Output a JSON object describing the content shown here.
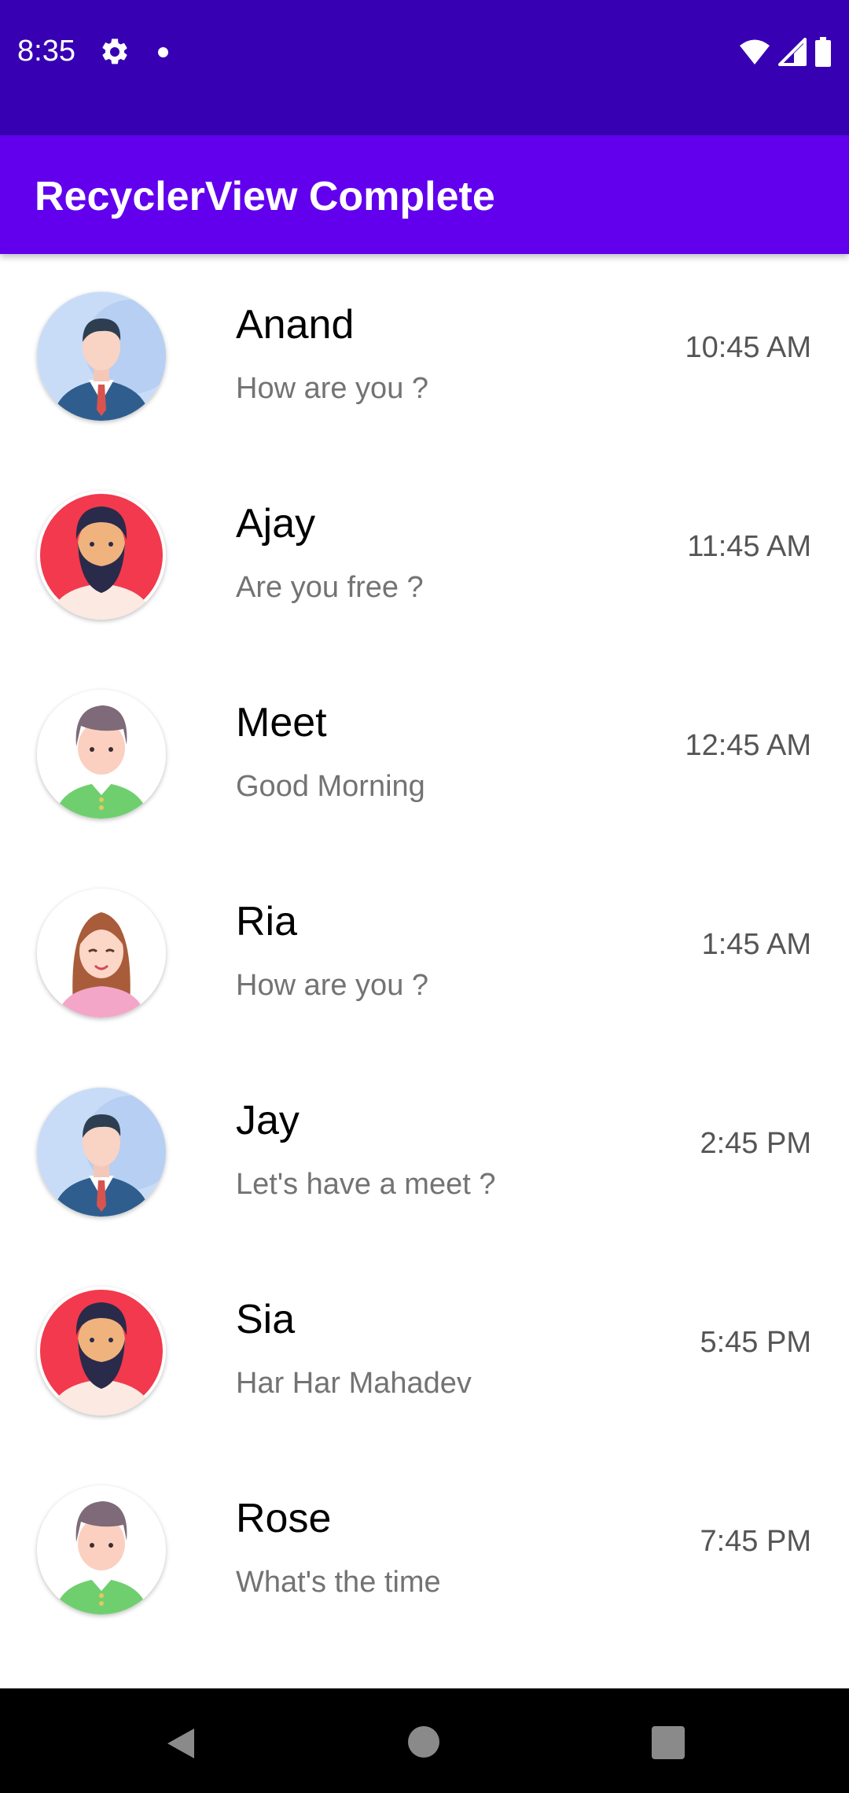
{
  "status_bar": {
    "time": "8:35",
    "icons": [
      "gear-icon",
      "notification-dot-icon",
      "wifi-icon",
      "signal-icon",
      "battery-icon"
    ]
  },
  "app_bar": {
    "title": "RecyclerView Complete",
    "color": "#6200ee",
    "status_color": "#3700b3"
  },
  "contacts": [
    {
      "name": "Anand",
      "message": "How are you ?",
      "time": "10:45 AM",
      "avatar": "businessman-avatar"
    },
    {
      "name": "Ajay",
      "message": "Are you free ?",
      "time": "11:45 AM",
      "avatar": "bearded-man-avatar"
    },
    {
      "name": "Meet",
      "message": "Good Morning",
      "time": "12:45 AM",
      "avatar": "boy-avatar"
    },
    {
      "name": "Ria",
      "message": "How are you ?",
      "time": "1:45 AM",
      "avatar": "girl-avatar"
    },
    {
      "name": "Jay",
      "message": "Let's have a meet ?",
      "time": "2:45 PM",
      "avatar": "businessman-avatar"
    },
    {
      "name": "Sia",
      "message": "Har Har Mahadev",
      "time": "5:45 PM",
      "avatar": "bearded-man-avatar"
    },
    {
      "name": "Rose",
      "message": "What's the time",
      "time": "7:45 PM",
      "avatar": "boy-avatar"
    }
  ],
  "nav_bar": {
    "icons": [
      "back-icon",
      "home-icon",
      "recents-icon"
    ]
  }
}
